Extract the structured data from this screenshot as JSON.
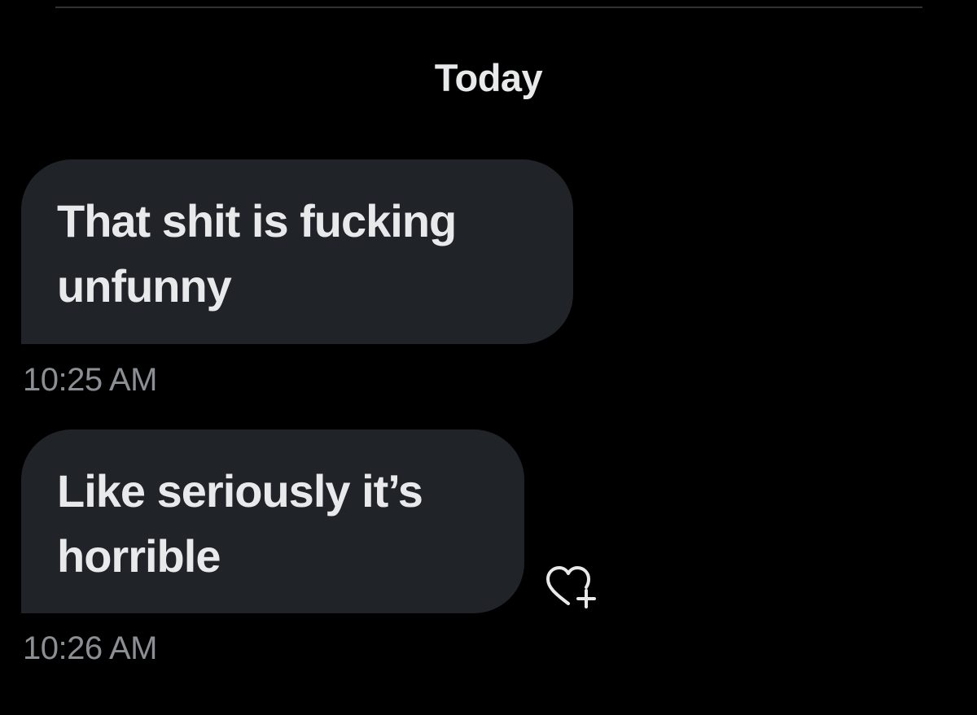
{
  "conversation": {
    "day_separator": "Today",
    "messages": [
      {
        "lines": [
          "That shit is fucking",
          "unfunny"
        ],
        "timestamp": "10:25 AM"
      },
      {
        "lines": [
          "Like seriously it’s",
          "horrible"
        ],
        "timestamp": "10:26 AM",
        "reaction_icon": "heart-plus-icon"
      }
    ]
  },
  "colors": {
    "background": "#000000",
    "bubble": "#202327",
    "text": "#e7e9ea",
    "timestamp": "#8b8f94",
    "divider": "#2f3336"
  }
}
